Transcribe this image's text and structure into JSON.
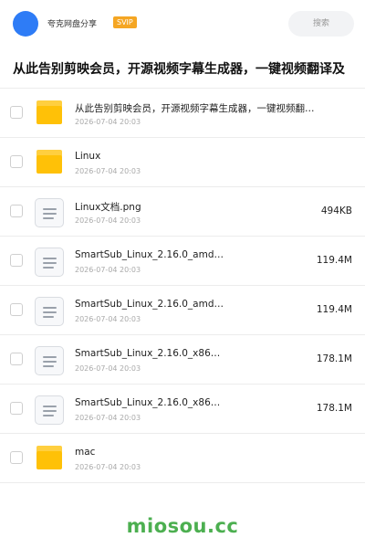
{
  "header": {
    "share_name": "夸克网盘分享",
    "badge": "SVIP",
    "search_placeholder": "搜索"
  },
  "page_title": "从此告别剪映会员，开源视频字幕生成器，一键视频翻译及",
  "files": [
    {
      "type": "folder",
      "name": "从此告别剪映会员，开源视频字幕生成器，一键视频翻…",
      "date": "2026-07-04 20:03",
      "size": ""
    },
    {
      "type": "folder",
      "name": "Linux",
      "date": "2026-07-04 20:03",
      "size": ""
    },
    {
      "type": "file",
      "name": "Linux文档.png",
      "date": "2026-07-04 20:03",
      "size": "494KB"
    },
    {
      "type": "file",
      "name": "SmartSub_Linux_2.16.0_amd…",
      "date": "2026-07-04 20:03",
      "size": "119.4M"
    },
    {
      "type": "file",
      "name": "SmartSub_Linux_2.16.0_amd…",
      "date": "2026-07-04 20:03",
      "size": "119.4M"
    },
    {
      "type": "file",
      "name": "SmartSub_Linux_2.16.0_x86…",
      "date": "2026-07-04 20:03",
      "size": "178.1M"
    },
    {
      "type": "file",
      "name": "SmartSub_Linux_2.16.0_x86…",
      "date": "2026-07-04 20:03",
      "size": "178.1M"
    },
    {
      "type": "folder",
      "name": "mac",
      "date": "2026-07-04 20:03",
      "size": ""
    }
  ],
  "watermark": "miosou.cc",
  "colors": {
    "accent": "#2e7cf6",
    "badge": "#f5a623",
    "folder": "#ffc107",
    "watermark": "#4caf50"
  }
}
